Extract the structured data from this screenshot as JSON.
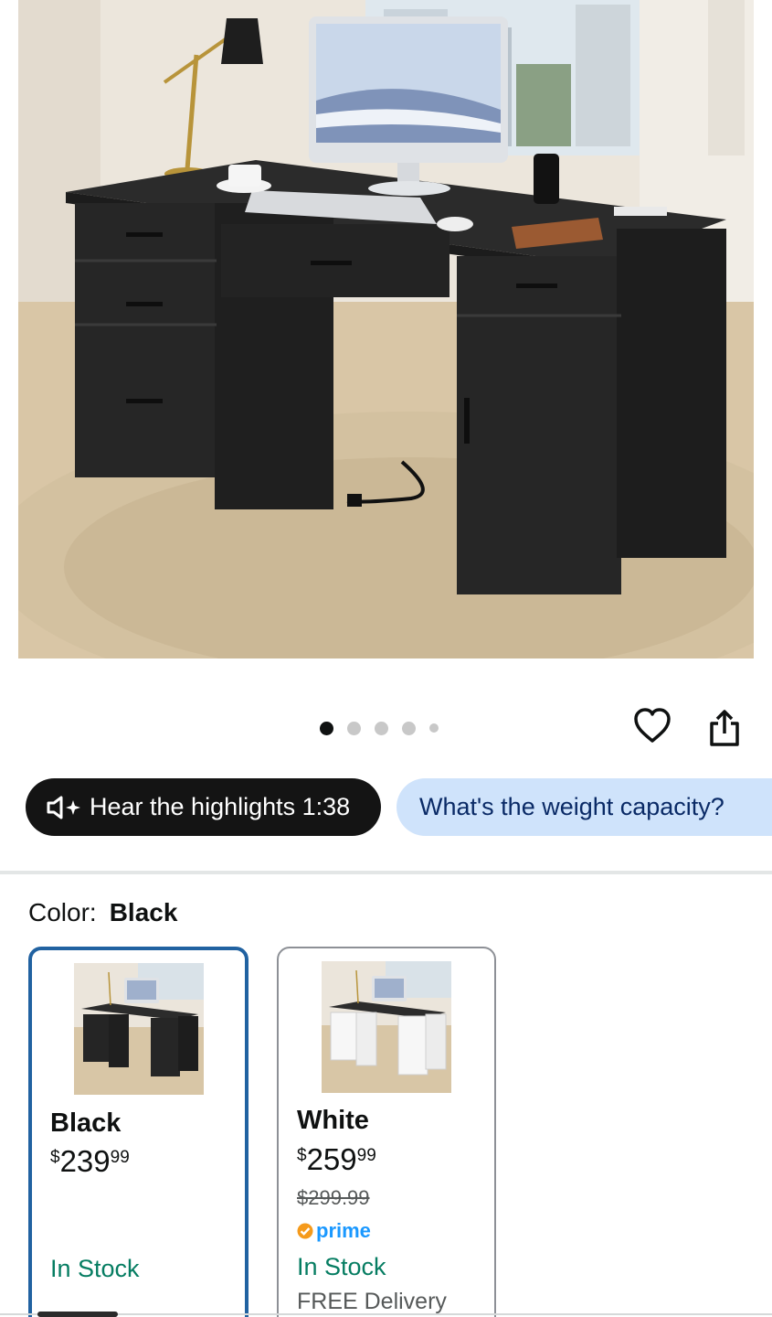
{
  "gallery": {
    "total_images": 5,
    "active_index": 0
  },
  "actions": {
    "favorite_icon": "heart-icon",
    "share_icon": "share-icon"
  },
  "pills": {
    "audio_label": "Hear the highlights 1:38",
    "audio_icon": "speaker-sparkle-icon",
    "question_label": "What's the weight capacity?"
  },
  "color_selector": {
    "label": "Color:",
    "selected": "Black",
    "options": [
      {
        "name": "Black",
        "price_symbol": "$",
        "price_whole": "239",
        "price_cents": "99",
        "stock": "In Stock"
      },
      {
        "name": "White",
        "price_symbol": "$",
        "price_whole": "259",
        "price_cents": "99",
        "list_price": "$299.99",
        "badge": "prime",
        "stock": "In Stock",
        "delivery": "FREE Delivery"
      }
    ]
  },
  "colors": {
    "selected_border": "#2162a1",
    "stock_green": "#067d62",
    "prime_blue": "#1a98ff",
    "dark_pill": "#141414",
    "light_pill": "#cfe3fb"
  }
}
